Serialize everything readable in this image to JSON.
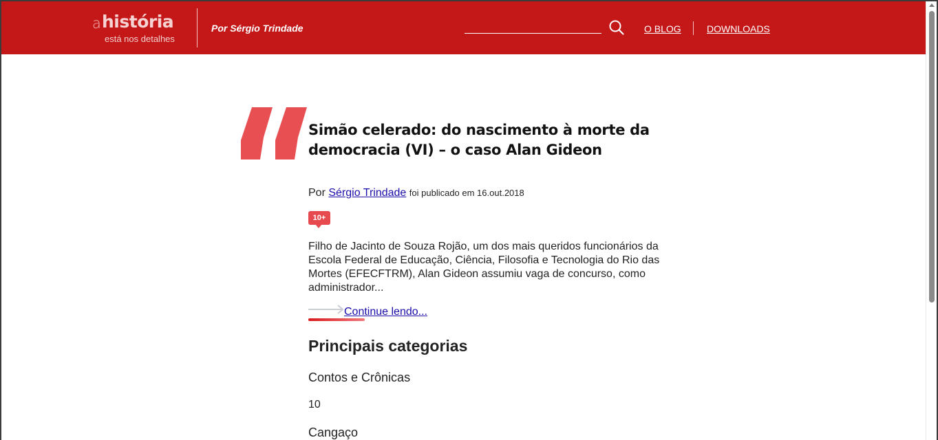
{
  "header": {
    "logo": {
      "prefix": "a",
      "word": "história",
      "tagline": "está nos detalhes"
    },
    "byline": "Por Sérgio Trindade",
    "search": {
      "value": "",
      "placeholder": ""
    },
    "nav": [
      {
        "label": "O BLOG"
      },
      {
        "label": "DOWNLOADS"
      }
    ],
    "colors": {
      "background": "#c41718",
      "quote": "#e84f53"
    }
  },
  "article": {
    "title": "Simão celerado: do nascimento à morte da democracia (VI) – o caso Alan Gideon",
    "meta": {
      "prefix": "Por",
      "author": "Sérgio Trindade",
      "published": "foi publicado em 16.out.2018"
    },
    "comments_badge": "10+",
    "excerpt": "Filho de Jacinto de Souza Rojão, um dos mais queridos funcionários da Escola Federal de Educação, Ciência, Filosofia e Tecnologia do Rio das Mortes (EFECFTRM), Alan Gideon assumiu vaga de concurso, como administrador...",
    "continue_label": "Continue lendo..."
  },
  "categories": {
    "heading": "Principais categorias",
    "items": [
      {
        "name": "Contos e Crônicas",
        "count": "10"
      },
      {
        "name": "Cangaço"
      }
    ]
  }
}
